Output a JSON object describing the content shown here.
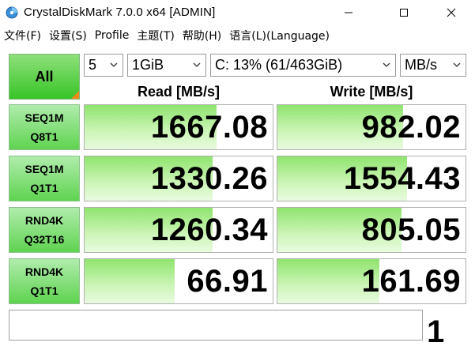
{
  "window": {
    "title": "CrystalDiskMark 7.0.0 x64 [ADMIN]",
    "icon": "app-disk-icon",
    "controls": [
      "minimize-icon",
      "maximize-icon",
      "close-icon"
    ]
  },
  "menu": {
    "items": [
      "文件(F)",
      "设置(S)",
      "Profile",
      "主题(T)",
      "帮助(H)",
      "语言(L)(Language)"
    ]
  },
  "toolbar": {
    "all_label": "All",
    "count": "5",
    "size": "1GiB",
    "drive": "C: 13% (61/463GiB)",
    "unit": "MB/s"
  },
  "headers": {
    "read": "Read [MB/s]",
    "write": "Write [MB/s]"
  },
  "tests": [
    {
      "line1": "SEQ1M",
      "line2": "Q8T1",
      "read": "1667.08",
      "write": "982.02",
      "read_fill": 0.7,
      "write_fill": 0.67
    },
    {
      "line1": "SEQ1M",
      "line2": "Q1T1",
      "read": "1330.26",
      "write": "1554.43",
      "read_fill": 0.68,
      "write_fill": 0.69
    },
    {
      "line1": "RND4K",
      "line2": "Q32T16",
      "read": "1260.34",
      "write": "805.05",
      "read_fill": 0.68,
      "write_fill": 0.66
    },
    {
      "line1": "RND4K",
      "line2": "Q1T1",
      "read": "66.91",
      "write": "161.69",
      "read_fill": 0.48,
      "write_fill": 0.54
    }
  ],
  "footer": {
    "comment": "",
    "digit": "1"
  },
  "colors": {
    "accent_green": "#38c428",
    "corner_orange": "#f08a18"
  }
}
